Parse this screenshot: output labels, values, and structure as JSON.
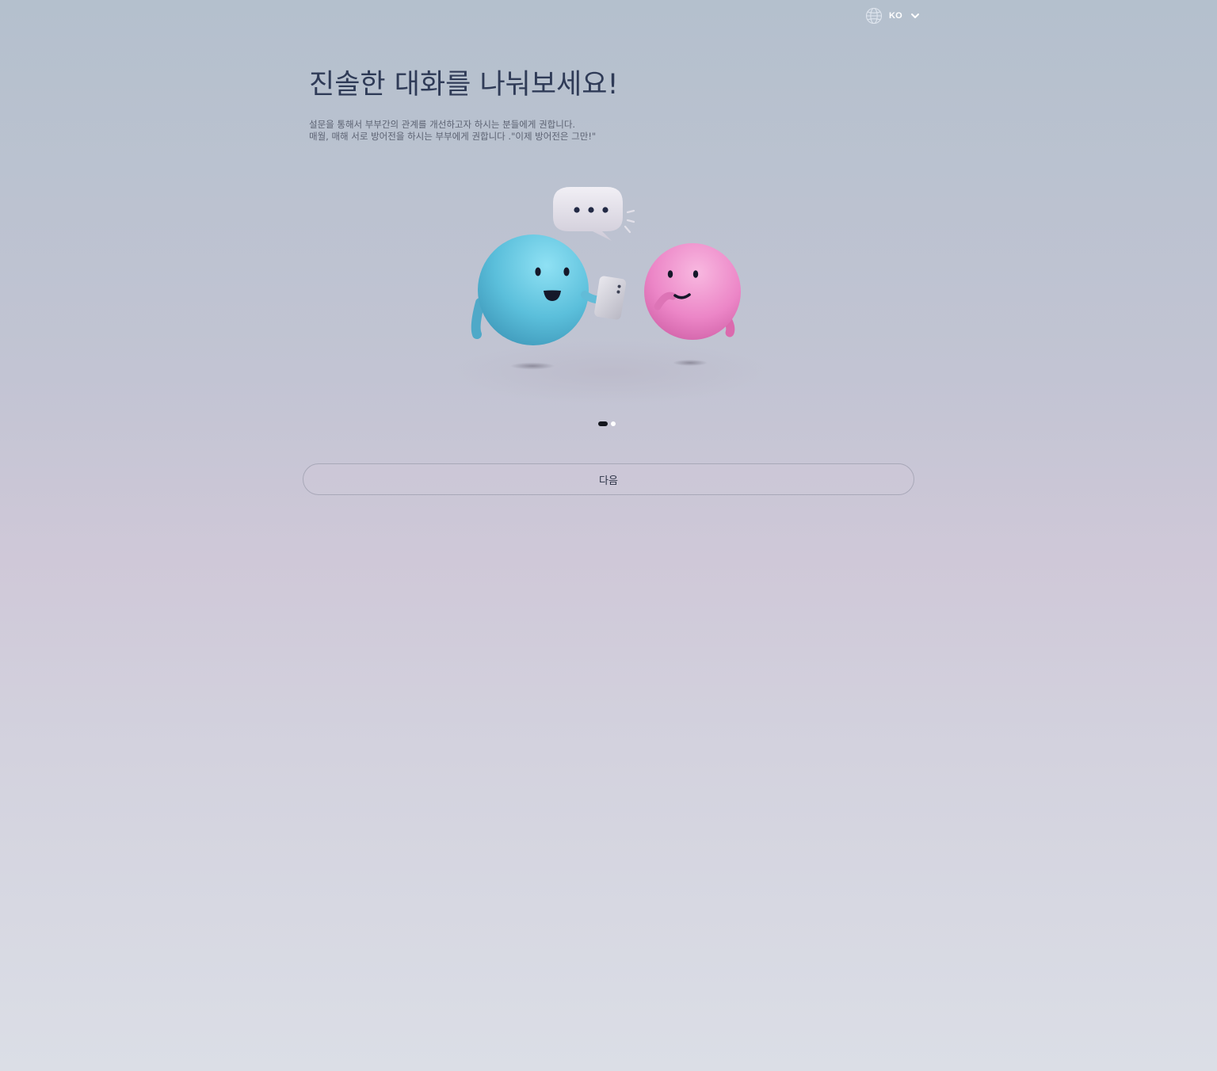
{
  "language_selector": {
    "code": "KO",
    "icon": "globe-icon",
    "dropdown_icon": "chevron-down-icon"
  },
  "intro": {
    "title": "진솔한 대화를 나눠보세요!",
    "description_lines": [
      "설문을 통해서 부부간의 관계를 개선하고자 하시는 분들에게 권합니다.",
      "매월, 매해 서로 방어전을 하시는 부부에게 권합니다 .\"이제 방어전은 그만!\""
    ]
  },
  "illustration": {
    "subject": "two-characters-chatting",
    "speech_bubble_icon": "speech-bubble-icon",
    "phone_icon": "phone-icon"
  },
  "pagination": {
    "total": 2,
    "current": 1
  },
  "next_button": {
    "label": "다음"
  },
  "colors": {
    "title": "#2f3b57",
    "blue_character": "#5cc0de",
    "pink_character": "#ec84c6",
    "active_dot": "#14161d",
    "button_border": "#a8a8b8"
  }
}
